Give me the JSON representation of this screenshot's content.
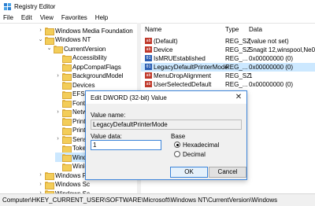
{
  "window": {
    "title": "Registry Editor"
  },
  "menu": [
    "File",
    "Edit",
    "View",
    "Favorites",
    "Help"
  ],
  "tree": [
    {
      "label": "Windows Media Foundation",
      "expander": ">",
      "level": 2
    },
    {
      "label": "Windows NT",
      "expander": "v",
      "level": 2
    },
    {
      "label": "CurrentVersion",
      "expander": "v",
      "level": 3
    },
    {
      "label": "Accessibility",
      "expander": "",
      "level": 4
    },
    {
      "label": "AppCompatFlags",
      "expander": "",
      "level": 4
    },
    {
      "label": "BackgroundModel",
      "expander": ">",
      "level": 4
    },
    {
      "label": "Devices",
      "expander": "",
      "level": 4
    },
    {
      "label": "EFS",
      "expander": "",
      "level": 4
    },
    {
      "label": "Font",
      "expander": "",
      "level": 4
    },
    {
      "label": "Netw",
      "expander": ">",
      "level": 4
    },
    {
      "label": "Printe",
      "expander": "",
      "level": 4
    },
    {
      "label": "Printe",
      "expander": "",
      "level": 4
    },
    {
      "label": "Sense",
      "expander": ">",
      "level": 4
    },
    {
      "label": "Toke",
      "expander": "",
      "level": 4
    },
    {
      "label": "Wind",
      "expander": "",
      "level": 4,
      "selected": true
    },
    {
      "label": "Winlo",
      "expander": "",
      "level": 4
    },
    {
      "label": "Windows Ph",
      "expander": ">",
      "level": 2
    },
    {
      "label": "Windows Sc",
      "expander": ">",
      "level": 2
    },
    {
      "label": "Windows Sc",
      "expander": ">",
      "level": 2
    }
  ],
  "values": {
    "headers": {
      "name": "Name",
      "type": "Type",
      "data": "Data"
    },
    "rows": [
      {
        "icon": "ab",
        "name": "(Default)",
        "type": "REG_SZ",
        "data": "(value not set)"
      },
      {
        "icon": "ab",
        "name": "Device",
        "type": "REG_SZ",
        "data": "Snagit 12,winspool,Ne00:"
      },
      {
        "icon": "dw",
        "name": "IsMRUEstablished",
        "type": "REG_...",
        "data": "0x00000000 (0)"
      },
      {
        "icon": "dw",
        "name": "LegacyDefaultPrinterMode",
        "type": "REG_...",
        "data": "0x00000000 (0)",
        "selected": true
      },
      {
        "icon": "ab",
        "name": "MenuDropAlignment",
        "type": "REG_SZ",
        "data": "1"
      },
      {
        "icon": "ab",
        "name": "UserSelectedDefault",
        "type": "REG_...",
        "data": "0x00000000 (0)"
      }
    ]
  },
  "status": "Computer\\HKEY_CURRENT_USER\\SOFTWARE\\Microsoft\\Windows NT\\CurrentVersion\\Windows",
  "dialog": {
    "title": "Edit DWORD (32-bit) Value",
    "close": "✕",
    "value_name_label": "Value name:",
    "value_name": "LegacyDefaultPrinterMode",
    "value_data_label": "Value data:",
    "value_data": "1",
    "base_label": "Base",
    "hex_label": "Hexadecimal",
    "dec_label": "Decimal",
    "selected_base": "Hexadecimal",
    "ok": "OK",
    "cancel": "Cancel"
  },
  "colors": {
    "selection": "#cce8ff",
    "accent": "#3c84d9"
  }
}
